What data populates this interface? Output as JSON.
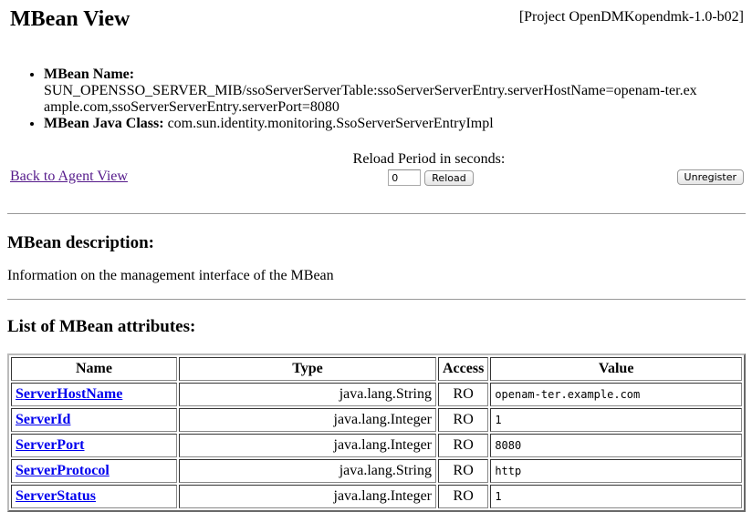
{
  "header": {
    "title": "MBean View",
    "project": "[Project OpenDMKopendmk-1.0-b02]"
  },
  "info": {
    "name_label": "MBean Name:",
    "name_value": "SUN_OPENSSO_SERVER_MIB/ssoServerServerTable:ssoServerServerEntry.serverHostName=openam-ter.example.com,ssoServerServerEntry.serverPort=8080",
    "class_label": "MBean Java Class:",
    "class_value": "com.sun.identity.monitoring.SsoServerServerEntryImpl"
  },
  "controls": {
    "back_link": "Back to Agent View",
    "reload_label": "Reload Period in seconds:",
    "reload_value": "0",
    "reload_button": "Reload",
    "unregister_button": "Unregister"
  },
  "description": {
    "heading": "MBean description:",
    "text": "Information on the management interface of the MBean"
  },
  "attributes": {
    "heading": "List of MBean attributes:",
    "columns": [
      "Name",
      "Type",
      "Access",
      "Value"
    ],
    "rows": [
      {
        "name": "ServerHostName",
        "type": "java.lang.String",
        "access": "RO",
        "value": "openam-ter.example.com"
      },
      {
        "name": "ServerId",
        "type": "java.lang.Integer",
        "access": "RO",
        "value": "1"
      },
      {
        "name": "ServerPort",
        "type": "java.lang.Integer",
        "access": "RO",
        "value": "8080"
      },
      {
        "name": "ServerProtocol",
        "type": "java.lang.String",
        "access": "RO",
        "value": "http"
      },
      {
        "name": "ServerStatus",
        "type": "java.lang.Integer",
        "access": "RO",
        "value": "1"
      }
    ]
  }
}
